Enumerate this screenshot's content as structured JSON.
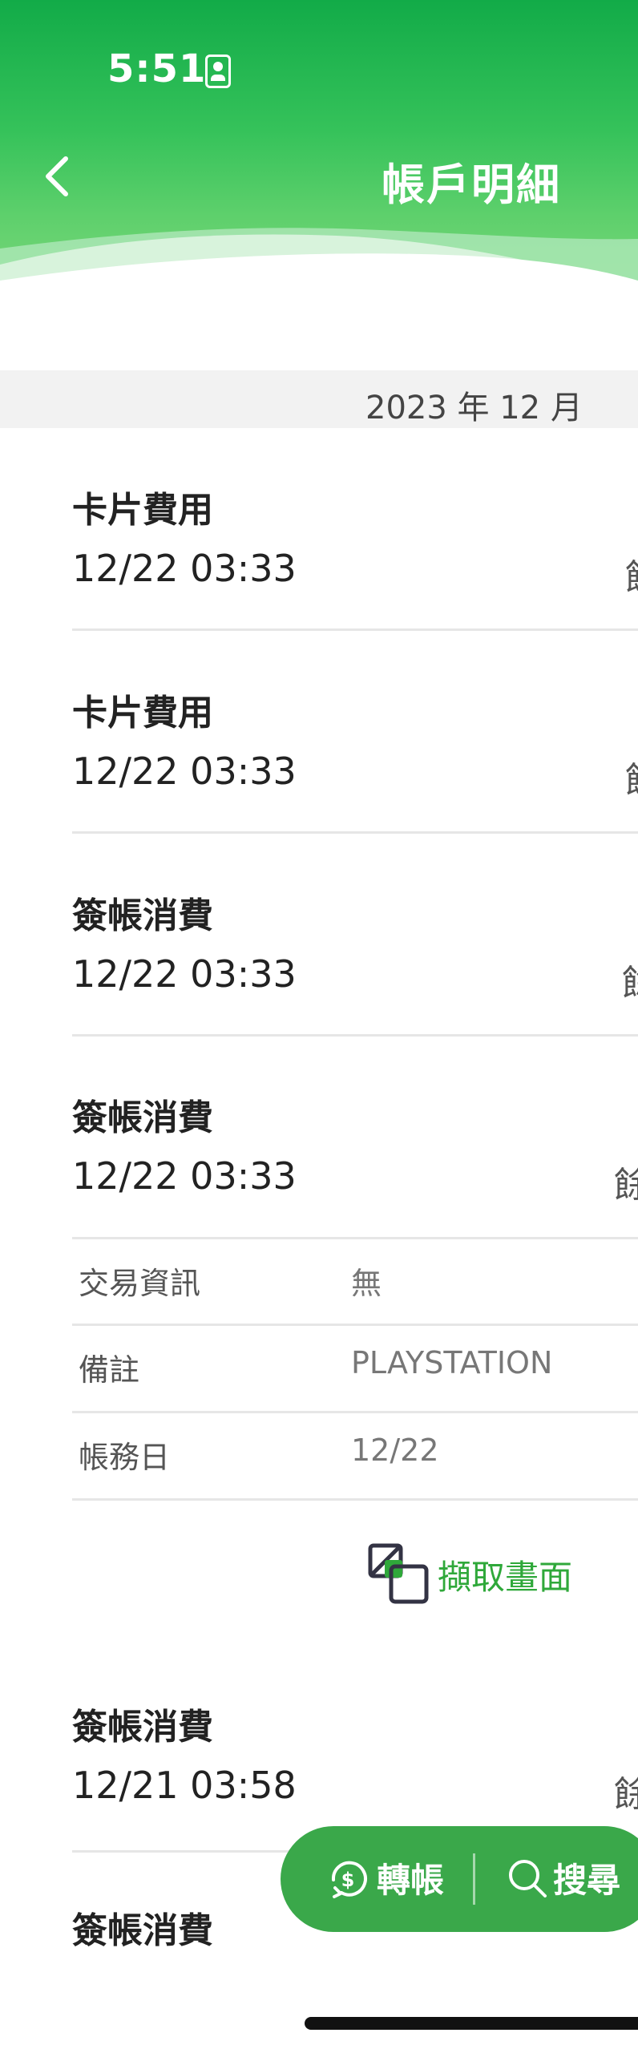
{
  "status_bar": {
    "time": "5:51"
  },
  "header": {
    "title": "帳戶明細"
  },
  "month_bar": {
    "label": "2023 年 12 月"
  },
  "transactions": [
    {
      "name": "卡片費用",
      "time": "12/22 03:33",
      "balance_label": "餘"
    },
    {
      "name": "卡片費用",
      "time": "12/22 03:33",
      "balance_label": "餘"
    },
    {
      "name": "簽帳消費",
      "time": "12/22 03:33",
      "balance_label": "餘"
    },
    {
      "name": "簽帳消費",
      "time": "12/22 03:33",
      "balance_label": "餘"
    },
    {
      "name": "簽帳消費",
      "time": "12/21 03:58",
      "balance_label": "餘"
    },
    {
      "name": "簽帳消費"
    }
  ],
  "detail": {
    "rows": [
      {
        "label": "交易資訊",
        "value": "無"
      },
      {
        "label": "備註",
        "value": "PLAYSTATION"
      },
      {
        "label": "帳務日",
        "value": "12/22"
      }
    ],
    "capture_label": "擷取畫面"
  },
  "fab": {
    "transfer_label": "轉帳",
    "search_label": "搜尋"
  },
  "colors": {
    "header_green": "#12ab48",
    "accent_green": "#2fa83a",
    "fab_green": "#3aa84a"
  }
}
